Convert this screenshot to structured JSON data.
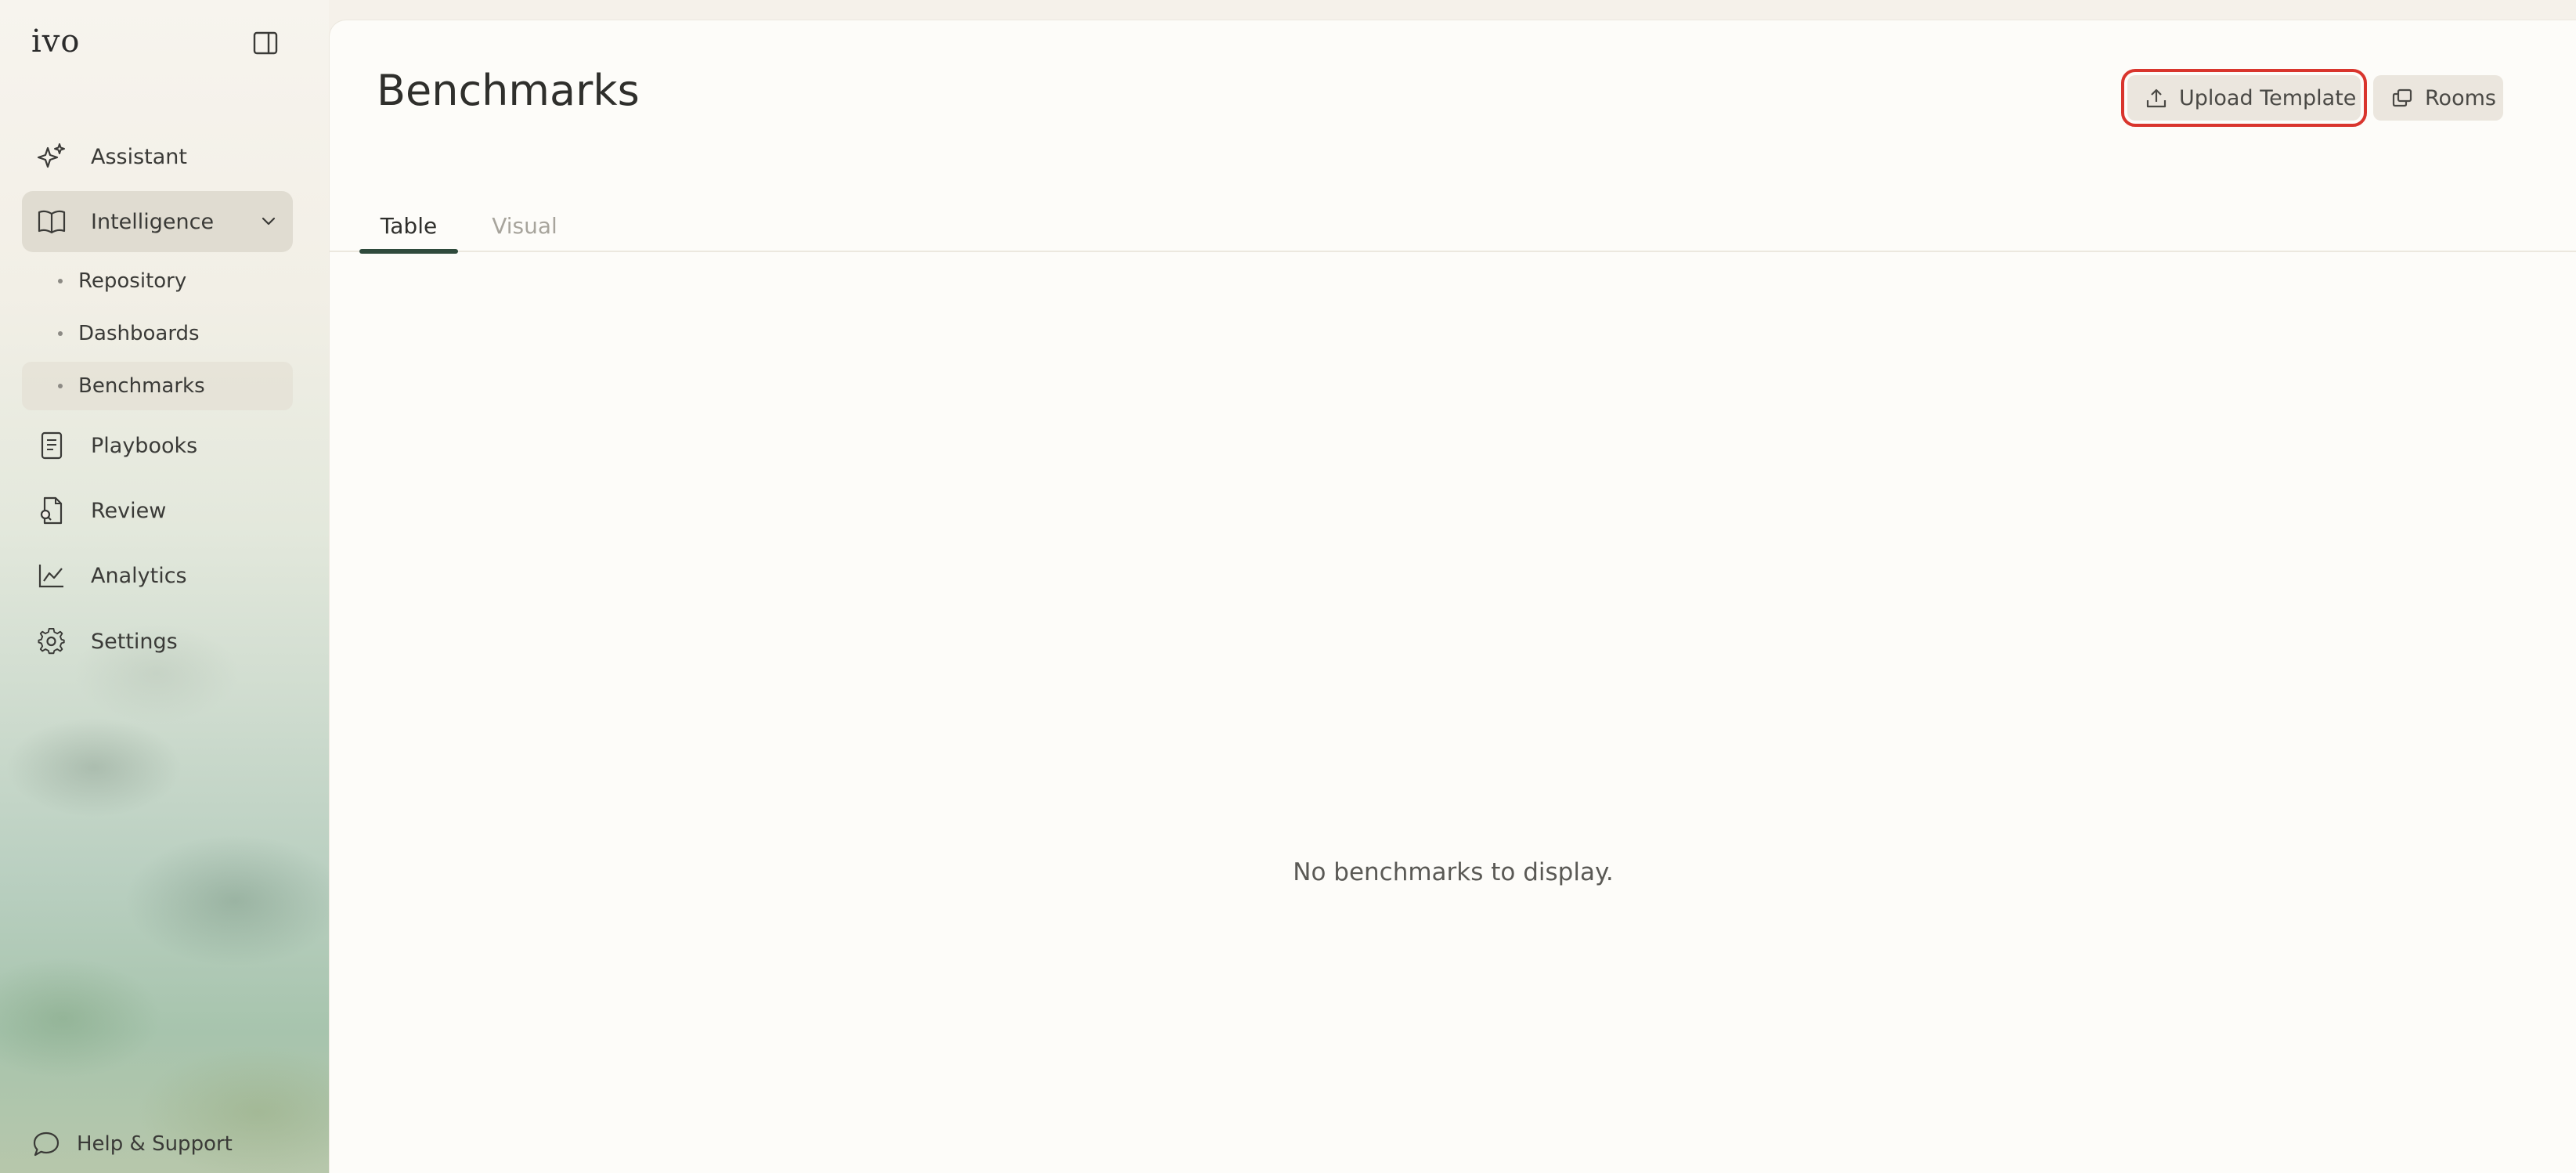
{
  "app": {
    "logo": "ivo"
  },
  "sidebar": {
    "items": [
      {
        "label": "Assistant",
        "icon": "sparkle-icon"
      },
      {
        "label": "Intelligence",
        "icon": "book-icon",
        "expanded": true
      },
      {
        "label": "Playbooks",
        "icon": "notebook-icon"
      },
      {
        "label": "Review",
        "icon": "document-search-icon"
      },
      {
        "label": "Analytics",
        "icon": "line-chart-icon"
      },
      {
        "label": "Settings",
        "icon": "gear-icon"
      }
    ],
    "sub_items": [
      {
        "label": "Repository"
      },
      {
        "label": "Dashboards"
      },
      {
        "label": "Benchmarks",
        "active": true
      }
    ],
    "help_label": "Help & Support"
  },
  "main": {
    "title": "Benchmarks",
    "upload_label": "Upload Template",
    "rooms_label": "Rooms",
    "tabs": [
      {
        "label": "Table",
        "active": true
      },
      {
        "label": "Visual"
      }
    ],
    "empty_message": "No benchmarks to display."
  },
  "colors": {
    "accent": "#2f4a3c",
    "highlight": "#d9352d",
    "background": "#fdfcf9"
  }
}
